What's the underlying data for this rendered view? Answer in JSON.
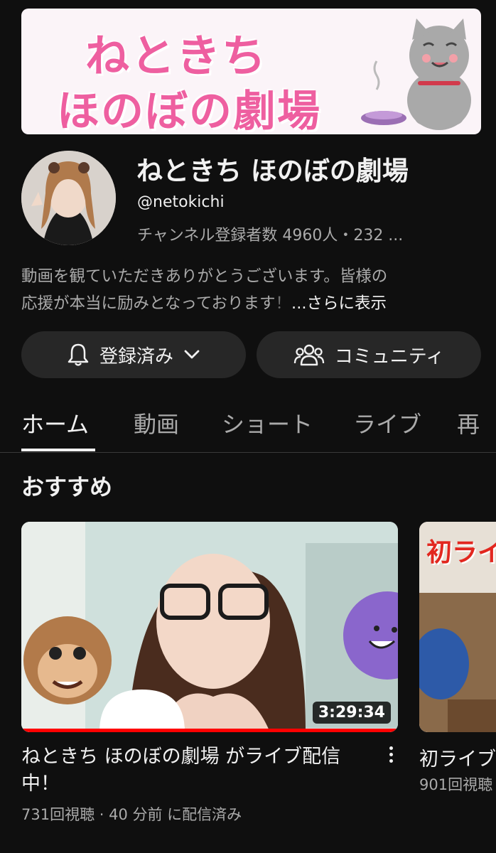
{
  "banner": {
    "line1": "ねときち",
    "line2": "ほのぼの劇場"
  },
  "channel": {
    "name": "ねときち ほのぼの劇場",
    "handle": "@netokichi",
    "stats": "チャンネル登録者数 4960人・232 ...",
    "description_line1": "動画を観ていただきありがとうございます。皆様の",
    "description_line2": "応援が本当に励みとなっております",
    "description_fade": "！",
    "more_link": "...さらに表示"
  },
  "buttons": {
    "subscribed": "登録済み",
    "community": "コミュニティ"
  },
  "tabs": [
    {
      "label": "ホーム",
      "active": true
    },
    {
      "label": "動画"
    },
    {
      "label": "ショート"
    },
    {
      "label": "ライブ"
    },
    {
      "label": "再"
    }
  ],
  "section": {
    "title": "おすすめ"
  },
  "videos": [
    {
      "title": "ねときち ほのぼの劇場 がライブ配信中！",
      "duration": "3:29:34",
      "meta": "731回視聴 · 40 分前 に配信済み"
    },
    {
      "thumb_text": "初ライ",
      "title": "初ライブ",
      "meta": "901回視聴"
    }
  ],
  "colors": {
    "background": "#0f0f0f",
    "banner_text": "#ee5fa0",
    "pill": "#272727",
    "progress": "#ff0000"
  },
  "icons": [
    "bell-icon",
    "chevron-down-icon",
    "community-icon",
    "more-vertical-icon"
  ]
}
